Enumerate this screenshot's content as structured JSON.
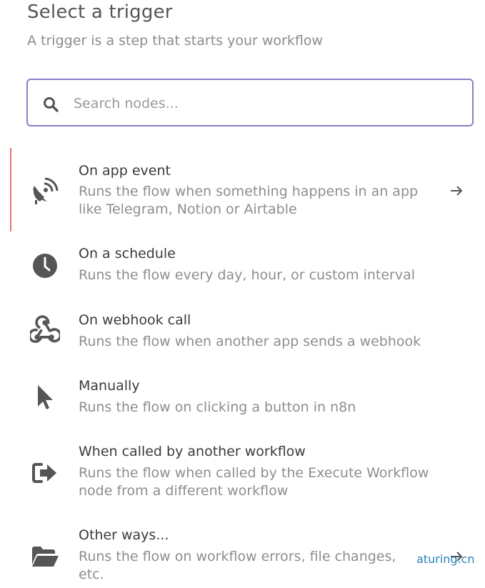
{
  "header": {
    "title": "Select a trigger",
    "subtitle": "A trigger is a step that starts your workflow"
  },
  "search": {
    "placeholder": "Search nodes..."
  },
  "triggers": [
    {
      "name": "On app event",
      "description": "Runs the flow when something happens in an app like Telegram, Notion or Airtable",
      "icon": "satellite-dish-icon",
      "has_arrow": true,
      "active": true
    },
    {
      "name": "On a schedule",
      "description": "Runs the flow every day, hour, or custom interval",
      "icon": "clock-icon",
      "has_arrow": false
    },
    {
      "name": "On webhook call",
      "description": "Runs the flow when another app sends a webhook",
      "icon": "webhook-icon",
      "has_arrow": false
    },
    {
      "name": "Manually",
      "description": "Runs the flow on clicking a button in n8n",
      "icon": "mouse-pointer-icon",
      "has_arrow": false
    },
    {
      "name": "When called by another workflow",
      "description": "Runs the flow when called by the Execute Workflow node from a different workflow",
      "icon": "sign-in-icon",
      "has_arrow": false
    },
    {
      "name": "Other ways...",
      "description": "Runs the flow on workflow errors, file changes, etc.",
      "icon": "folder-open-icon",
      "has_arrow": true
    }
  ],
  "watermark": "aturing.cn",
  "colors": {
    "accent": "#8a7fc6",
    "active_indicator": "#e8776f",
    "icon": "#555555",
    "title": "#555555",
    "description": "#8e8e8e"
  }
}
